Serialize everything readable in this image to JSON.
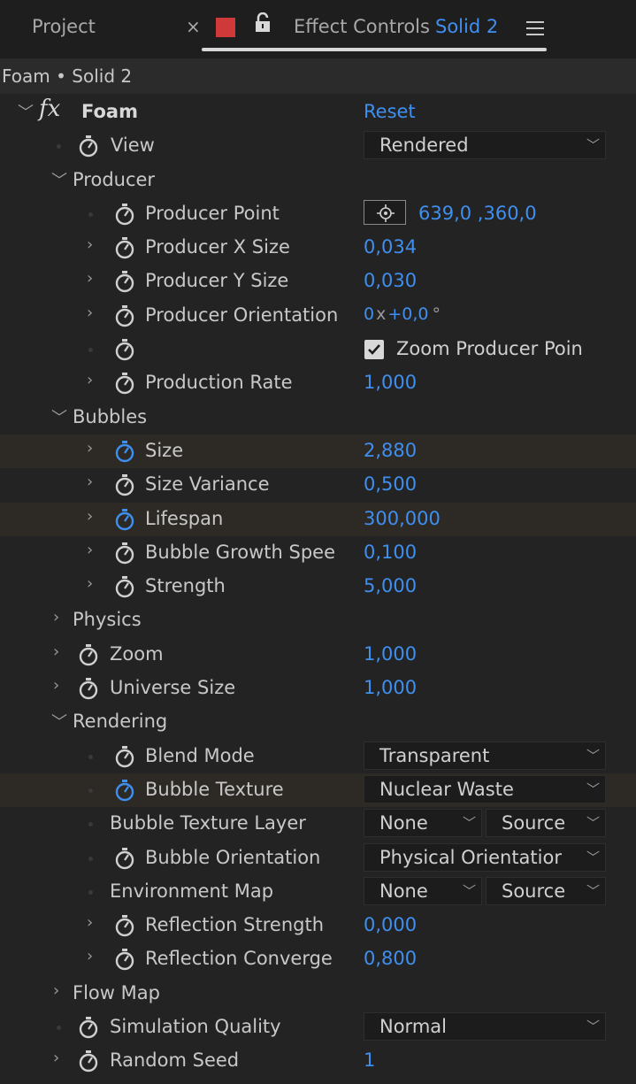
{
  "tabs": {
    "project": "Project",
    "close": "×",
    "effect_controls": "Effect Controls",
    "layer": "Solid 2"
  },
  "breadcrumb": "Foam • Solid 2",
  "effect": {
    "name": "Foam",
    "reset": "Reset"
  },
  "view": {
    "label": "View",
    "value": "Rendered"
  },
  "producer": {
    "label": "Producer",
    "point_label": "Producer Point",
    "point_value": "639,0 ,360,0",
    "x_size_label": "Producer X Size",
    "x_size": "0,034",
    "y_size_label": "Producer Y Size",
    "y_size": "0,030",
    "orientation_label": "Producer Orientation",
    "orientation_turns": "0",
    "orientation_x": "x",
    "orientation_deg": "+0,0",
    "orientation_unit": "°",
    "zoom_checkbox": "Zoom Producer Poin",
    "rate_label": "Production Rate",
    "rate": "1,000"
  },
  "bubbles": {
    "label": "Bubbles",
    "size_label": "Size",
    "size": "2,880",
    "variance_label": "Size Variance",
    "variance": "0,500",
    "lifespan_label": "Lifespan",
    "lifespan": "300,000",
    "growth_label": "Bubble Growth Spee",
    "growth": "0,100",
    "strength_label": "Strength",
    "strength": "5,000"
  },
  "physics": {
    "label": "Physics"
  },
  "zoom": {
    "label": "Zoom",
    "value": "1,000"
  },
  "universe": {
    "label": "Universe Size",
    "value": "1,000"
  },
  "rendering": {
    "label": "Rendering",
    "blend_label": "Blend Mode",
    "blend": "Transparent",
    "texture_label": "Bubble Texture",
    "texture": "Nuclear Waste",
    "texture_layer_label": "Bubble Texture Layer",
    "texture_layer": "None",
    "texture_layer_source": "Source",
    "orientation_label": "Bubble Orientation",
    "orientation": "Physical Orientatior",
    "env_label": "Environment Map",
    "env": "None",
    "env_source": "Source",
    "refl_strength_label": "Reflection Strength",
    "refl_strength": "0,000",
    "refl_converge_label": "Reflection Converge",
    "refl_converge": "0,800"
  },
  "flow_map": {
    "label": "Flow Map"
  },
  "quality": {
    "label": "Simulation Quality",
    "value": "Normal"
  },
  "seed": {
    "label": "Random Seed",
    "value": "1"
  },
  "colors": {
    "accent": "#3f8ff0",
    "bg": "#232323",
    "highlight": "#2d2a26",
    "label_red": "#d0393a"
  }
}
